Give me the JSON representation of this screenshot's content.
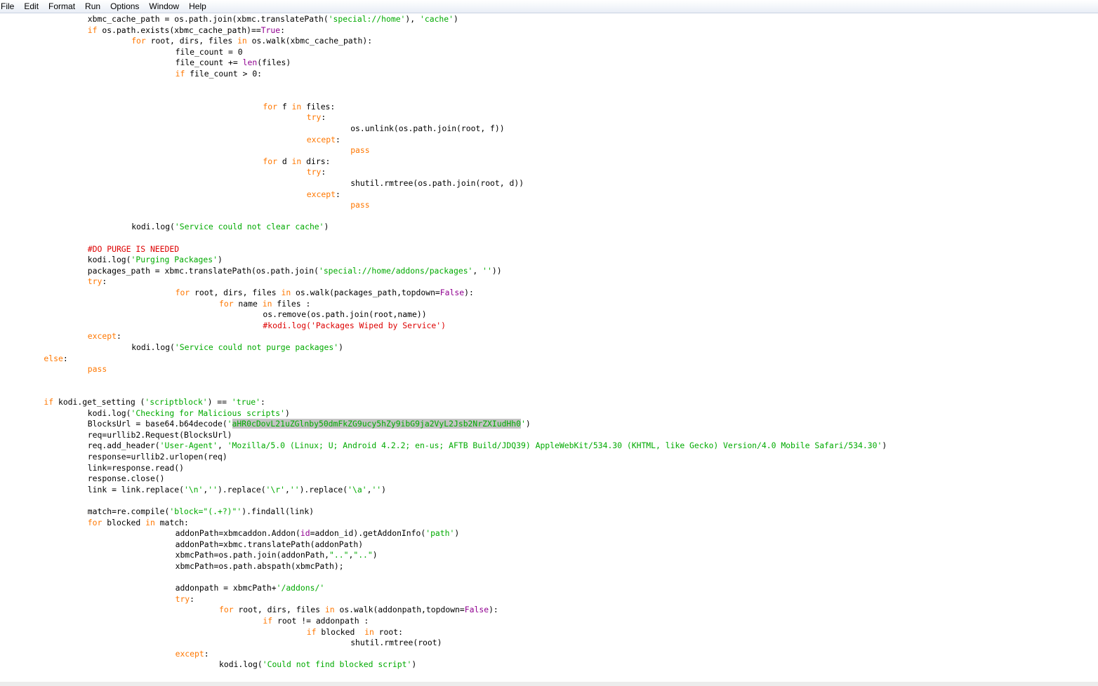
{
  "menu": [
    "File",
    "Edit",
    "Format",
    "Run",
    "Options",
    "Window",
    "Help"
  ],
  "code_lines": [
    {
      "indent": 2,
      "tokens": [
        [
          "t",
          "xbmc_cache_path = os.path.join(xbmc.translatePath("
        ],
        [
          "s",
          "'special://home'"
        ],
        [
          "t",
          "), "
        ],
        [
          "s",
          "'cache'"
        ],
        [
          "t",
          ")"
        ]
      ]
    },
    {
      "indent": 2,
      "tokens": [
        [
          "k",
          "if"
        ],
        [
          "t",
          " os.path.exists(xbmc_cache_path)=="
        ],
        [
          "b",
          "True"
        ],
        [
          "t",
          ":"
        ]
      ]
    },
    {
      "indent": 3,
      "tokens": [
        [
          "k",
          "for"
        ],
        [
          "t",
          " root, dirs, files "
        ],
        [
          "k",
          "in"
        ],
        [
          "t",
          " os.walk(xbmc_cache_path):"
        ]
      ]
    },
    {
      "indent": 4,
      "tokens": [
        [
          "t",
          "file_count = 0"
        ]
      ]
    },
    {
      "indent": 4,
      "tokens": [
        [
          "t",
          "file_count += "
        ],
        [
          "b",
          "len"
        ],
        [
          "t",
          "(files)"
        ]
      ]
    },
    {
      "indent": 4,
      "tokens": [
        [
          "k",
          "if"
        ],
        [
          "t",
          " file_count > 0:"
        ]
      ]
    },
    {
      "indent": 0,
      "tokens": []
    },
    {
      "indent": 0,
      "tokens": []
    },
    {
      "indent": 6,
      "tokens": [
        [
          "k",
          "for"
        ],
        [
          "t",
          " f "
        ],
        [
          "k",
          "in"
        ],
        [
          "t",
          " files:"
        ]
      ]
    },
    {
      "indent": 7,
      "tokens": [
        [
          "k",
          "try"
        ],
        [
          "t",
          ":"
        ]
      ]
    },
    {
      "indent": 8,
      "tokens": [
        [
          "t",
          "os.unlink(os.path.join(root, f))"
        ]
      ]
    },
    {
      "indent": 7,
      "tokens": [
        [
          "k",
          "except"
        ],
        [
          "t",
          ":"
        ]
      ]
    },
    {
      "indent": 8,
      "tokens": [
        [
          "k",
          "pass"
        ]
      ]
    },
    {
      "indent": 6,
      "tokens": [
        [
          "k",
          "for"
        ],
        [
          "t",
          " d "
        ],
        [
          "k",
          "in"
        ],
        [
          "t",
          " dirs:"
        ]
      ]
    },
    {
      "indent": 7,
      "tokens": [
        [
          "k",
          "try"
        ],
        [
          "t",
          ":"
        ]
      ]
    },
    {
      "indent": 8,
      "tokens": [
        [
          "t",
          "shutil.rmtree(os.path.join(root, d))"
        ]
      ]
    },
    {
      "indent": 7,
      "tokens": [
        [
          "k",
          "except"
        ],
        [
          "t",
          ":"
        ]
      ]
    },
    {
      "indent": 8,
      "tokens": [
        [
          "k",
          "pass"
        ]
      ]
    },
    {
      "indent": 0,
      "tokens": []
    },
    {
      "indent": 3,
      "tokens": [
        [
          "t",
          "kodi.log("
        ],
        [
          "s",
          "'Service could not clear cache'"
        ],
        [
          "t",
          ")"
        ]
      ]
    },
    {
      "indent": 0,
      "tokens": []
    },
    {
      "indent": 2,
      "tokens": [
        [
          "c",
          "#DO PURGE IS NEEDED"
        ]
      ]
    },
    {
      "indent": 2,
      "tokens": [
        [
          "t",
          "kodi.log("
        ],
        [
          "s",
          "'Purging Packages'"
        ],
        [
          "t",
          ")"
        ]
      ]
    },
    {
      "indent": 2,
      "tokens": [
        [
          "t",
          "packages_path = xbmc.translatePath(os.path.join("
        ],
        [
          "s",
          "'special://home/addons/packages'"
        ],
        [
          "t",
          ", "
        ],
        [
          "s",
          "''"
        ],
        [
          "t",
          "))"
        ]
      ]
    },
    {
      "indent": 2,
      "tokens": [
        [
          "k",
          "try"
        ],
        [
          "t",
          ":"
        ]
      ]
    },
    {
      "indent": 4,
      "tokens": [
        [
          "k",
          "for"
        ],
        [
          "t",
          " root, dirs, files "
        ],
        [
          "k",
          "in"
        ],
        [
          "t",
          " os.walk(packages_path,topdown="
        ],
        [
          "b",
          "False"
        ],
        [
          "t",
          "):"
        ]
      ]
    },
    {
      "indent": 5,
      "tokens": [
        [
          "k",
          "for"
        ],
        [
          "t",
          " name "
        ],
        [
          "k",
          "in"
        ],
        [
          "t",
          " files :"
        ]
      ]
    },
    {
      "indent": 6,
      "tokens": [
        [
          "t",
          "os.remove(os.path.join(root,name))"
        ]
      ]
    },
    {
      "indent": 6,
      "tokens": [
        [
          "c",
          "#kodi.log('Packages Wiped by Service')"
        ]
      ]
    },
    {
      "indent": 2,
      "tokens": [
        [
          "k",
          "except"
        ],
        [
          "t",
          ":"
        ]
      ]
    },
    {
      "indent": 3,
      "tokens": [
        [
          "t",
          "kodi.log("
        ],
        [
          "s",
          "'Service could not purge packages'"
        ],
        [
          "t",
          ")"
        ]
      ]
    },
    {
      "indent": 1,
      "tokens": [
        [
          "k",
          "else"
        ],
        [
          "t",
          ":"
        ]
      ]
    },
    {
      "indent": 2,
      "tokens": [
        [
          "k",
          "pass"
        ]
      ]
    },
    {
      "indent": 0,
      "tokens": []
    },
    {
      "indent": 0,
      "tokens": []
    },
    {
      "indent": 1,
      "tokens": [
        [
          "k",
          "if"
        ],
        [
          "t",
          " kodi.get_setting ("
        ],
        [
          "s",
          "'scriptblock'"
        ],
        [
          "t",
          ") == "
        ],
        [
          "s",
          "'true'"
        ],
        [
          "t",
          ":"
        ]
      ]
    },
    {
      "indent": 2,
      "tokens": [
        [
          "t",
          "kodi.log("
        ],
        [
          "s",
          "'Checking for Malicious scripts'"
        ],
        [
          "t",
          ")"
        ]
      ]
    },
    {
      "indent": 2,
      "tokens": [
        [
          "t",
          "BlocksUrl = base64.b64decode("
        ],
        [
          "s",
          "'"
        ],
        [
          "h",
          "aHR0cDovL21uZGlnby50dmFkZG9ucy5hZy9ibG9ja2VyL2Jsb2NrZXIudHh0"
        ],
        [
          "s",
          "'"
        ],
        [
          "t",
          ")"
        ]
      ]
    },
    {
      "indent": 2,
      "tokens": [
        [
          "t",
          "req=urllib2.Request(BlocksUrl)"
        ]
      ]
    },
    {
      "indent": 2,
      "tokens": [
        [
          "t",
          "req.add_header("
        ],
        [
          "s",
          "'User-Agent'"
        ],
        [
          "t",
          ", "
        ],
        [
          "s",
          "'Mozilla/5.0 (Linux; U; Android 4.2.2; en-us; AFTB Build/JDQ39) AppleWebKit/534.30 (KHTML, like Gecko) Version/4.0 Mobile Safari/534.30'"
        ],
        [
          "t",
          ")"
        ]
      ]
    },
    {
      "indent": 2,
      "tokens": [
        [
          "t",
          "response=urllib2.urlopen(req)"
        ]
      ]
    },
    {
      "indent": 2,
      "tokens": [
        [
          "t",
          "link=response.read()"
        ]
      ]
    },
    {
      "indent": 2,
      "tokens": [
        [
          "t",
          "response.close()"
        ]
      ]
    },
    {
      "indent": 2,
      "tokens": [
        [
          "t",
          "link = link.replace("
        ],
        [
          "s",
          "'\\n'"
        ],
        [
          "t",
          ","
        ],
        [
          "s",
          "''"
        ],
        [
          "t",
          ").replace("
        ],
        [
          "s",
          "'\\r'"
        ],
        [
          "t",
          ","
        ],
        [
          "s",
          "''"
        ],
        [
          "t",
          ").replace("
        ],
        [
          "s",
          "'\\a'"
        ],
        [
          "t",
          ","
        ],
        [
          "s",
          "''"
        ],
        [
          "t",
          ")"
        ]
      ]
    },
    {
      "indent": 0,
      "tokens": []
    },
    {
      "indent": 2,
      "tokens": [
        [
          "t",
          "match=re.compile("
        ],
        [
          "s",
          "'block=\"(.+?)\"'"
        ],
        [
          "t",
          ").findall(link)"
        ]
      ]
    },
    {
      "indent": 2,
      "tokens": [
        [
          "k",
          "for"
        ],
        [
          "t",
          " blocked "
        ],
        [
          "k",
          "in"
        ],
        [
          "t",
          " match:"
        ]
      ]
    },
    {
      "indent": 4,
      "tokens": [
        [
          "t",
          "addonPath=xbmcaddon.Addon("
        ],
        [
          "b",
          "id"
        ],
        [
          "t",
          "=addon_id).getAddonInfo("
        ],
        [
          "s",
          "'path'"
        ],
        [
          "t",
          ")"
        ]
      ]
    },
    {
      "indent": 4,
      "tokens": [
        [
          "t",
          "addonPath=xbmc.translatePath(addonPath)"
        ]
      ]
    },
    {
      "indent": 4,
      "tokens": [
        [
          "t",
          "xbmcPath=os.path.join(addonPath,"
        ],
        [
          "s",
          "\"..\""
        ],
        [
          "t",
          ","
        ],
        [
          "s",
          "\"..\""
        ],
        [
          "t",
          ")"
        ]
      ]
    },
    {
      "indent": 4,
      "tokens": [
        [
          "t",
          "xbmcPath=os.path.abspath(xbmcPath);"
        ]
      ]
    },
    {
      "indent": 0,
      "tokens": []
    },
    {
      "indent": 4,
      "tokens": [
        [
          "t",
          "addonpath = xbmcPath+"
        ],
        [
          "s",
          "'/addons/'"
        ]
      ]
    },
    {
      "indent": 4,
      "tokens": [
        [
          "k",
          "try"
        ],
        [
          "t",
          ":"
        ]
      ]
    },
    {
      "indent": 5,
      "tokens": [
        [
          "k",
          "for"
        ],
        [
          "t",
          " root, dirs, files "
        ],
        [
          "k",
          "in"
        ],
        [
          "t",
          " os.walk(addonpath,topdown="
        ],
        [
          "b",
          "False"
        ],
        [
          "t",
          "):"
        ]
      ]
    },
    {
      "indent": 6,
      "tokens": [
        [
          "k",
          "if"
        ],
        [
          "t",
          " root != addonpath :"
        ]
      ]
    },
    {
      "indent": 7,
      "tokens": [
        [
          "k",
          "if"
        ],
        [
          "t",
          " blocked  "
        ],
        [
          "k",
          "in"
        ],
        [
          "t",
          " root:"
        ]
      ]
    },
    {
      "indent": 8,
      "tokens": [
        [
          "t",
          "shutil.rmtree(root)"
        ]
      ]
    },
    {
      "indent": 4,
      "tokens": [
        [
          "k",
          "except"
        ],
        [
          "t",
          ":"
        ]
      ]
    },
    {
      "indent": 5,
      "tokens": [
        [
          "t",
          "kodi.log("
        ],
        [
          "s",
          "'Could not find blocked script'"
        ],
        [
          "t",
          ")"
        ]
      ]
    }
  ]
}
